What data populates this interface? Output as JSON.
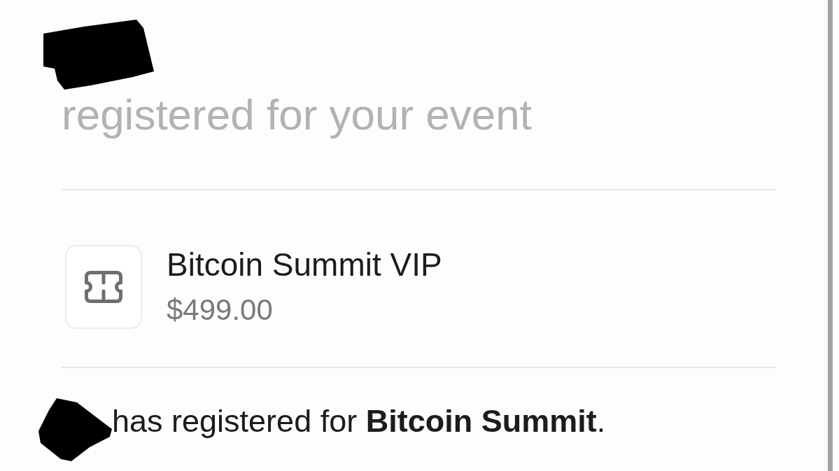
{
  "heading": "registered for your event",
  "ticket": {
    "name": "Bitcoin Summit VIP",
    "price": "$499.00"
  },
  "message": "has registered for **Bitcoin Summit**."
}
